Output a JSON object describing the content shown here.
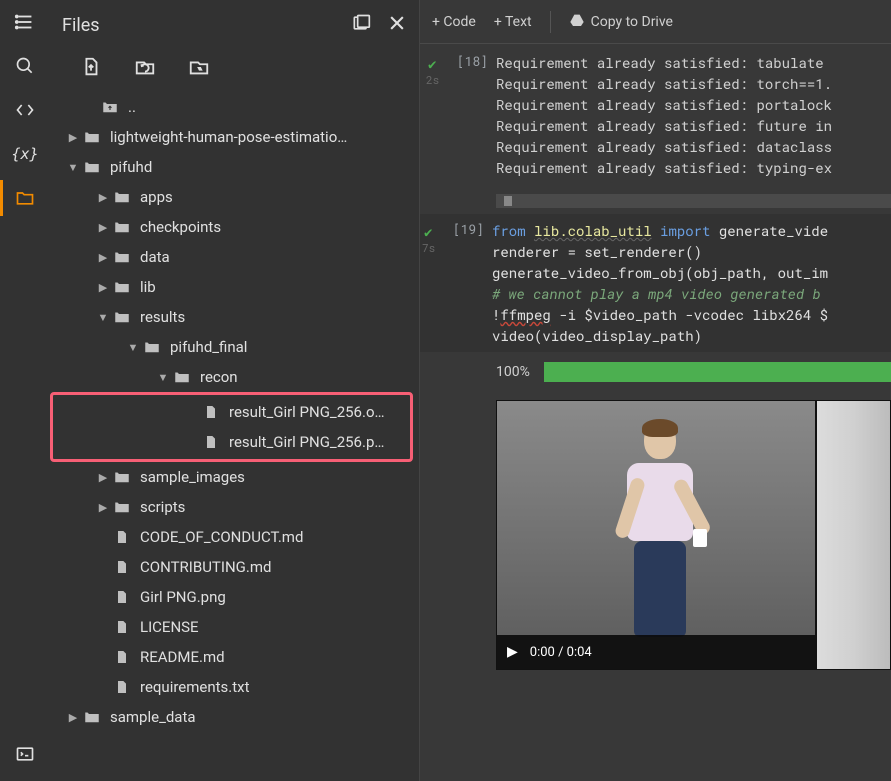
{
  "header": {
    "title": "Files"
  },
  "toolbar": {
    "add_code": "+ Code",
    "add_text": "+ Text",
    "copy_drive": "Copy to Drive"
  },
  "tree": {
    "root_up": "..",
    "items": {
      "lwhpe": "lightweight-human-pose-estimatio…",
      "pifuhd": "pifuhd",
      "apps": "apps",
      "checkpoints": "checkpoints",
      "data": "data",
      "lib": "lib",
      "results": "results",
      "pifuhd_final": "pifuhd_final",
      "recon": "recon",
      "result_o": "result_Girl PNG_256.o…",
      "result_p": "result_Girl PNG_256.p…",
      "sample_images": "sample_images",
      "scripts": "scripts",
      "code_of_conduct": "CODE_OF_CONDUCT.md",
      "contributing": "CONTRIBUTING.md",
      "girl_png": "Girl PNG.png",
      "license": "LICENSE",
      "readme": "README.md",
      "requirements": "requirements.txt",
      "sample_data": "sample_data"
    }
  },
  "cells": {
    "c18": {
      "prompt": "[18]",
      "time": "2s",
      "lines": [
        "Requirement already satisfied: tabulate ",
        "Requirement already satisfied: torch==1.",
        "Requirement already satisfied: portalock",
        "Requirement already satisfied: future in",
        "Requirement already satisfied: dataclass",
        "Requirement already satisfied: typing-ex"
      ]
    },
    "c19": {
      "prompt": "[19]",
      "time": "7s",
      "code": {
        "l1a": "from",
        "l1b": "lib.colab_util",
        "l1c": "import",
        "l1d": "generate_vide",
        "l2": "",
        "l3": "renderer = set_renderer()",
        "l4": "generate_video_from_obj(obj_path, out_im",
        "l5": "",
        "l6": "# we cannot play a mp4 video generated b",
        "l7a": "!",
        "l7b": "ffmpeg",
        "l7c": " -i $video_path -vcodec libx264 $",
        "l8": "video(video_display_path)"
      }
    }
  },
  "progress": {
    "label": "100%"
  },
  "video": {
    "time": "0:00 / 0:04"
  }
}
